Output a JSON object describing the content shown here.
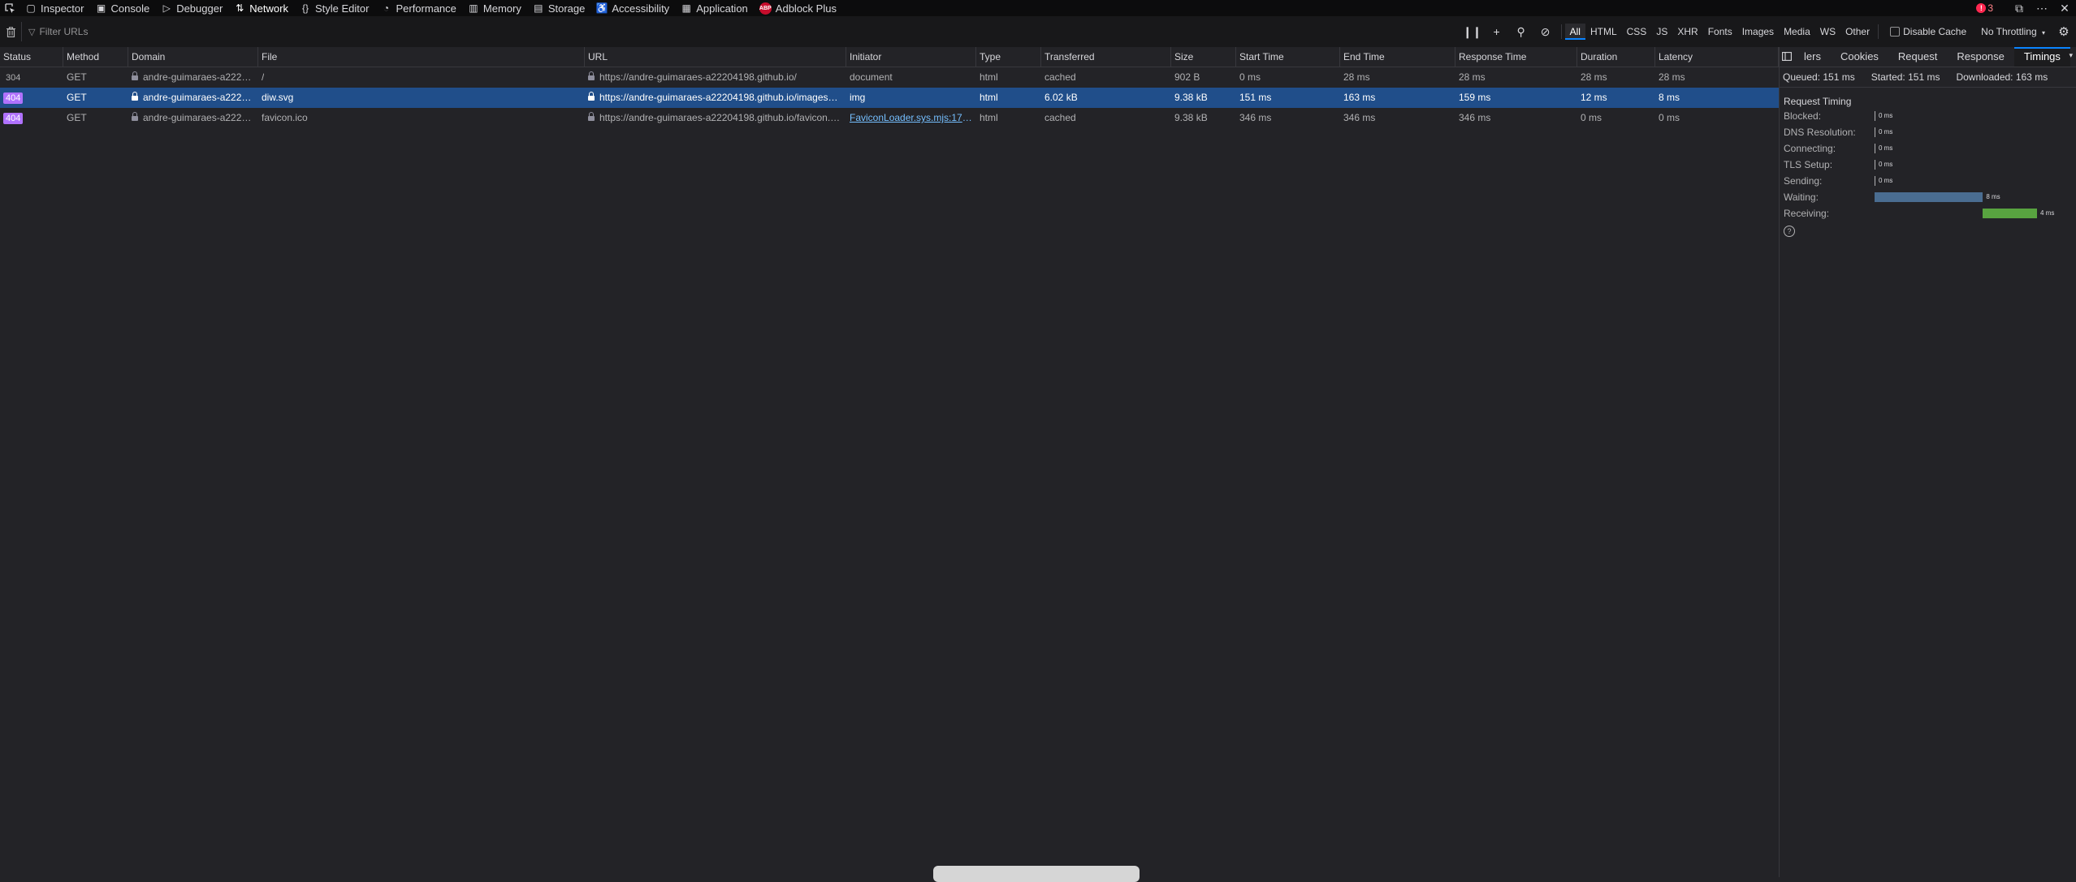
{
  "toolbar": {
    "tabs": [
      {
        "label": "Inspector",
        "icon": "inspector-icon"
      },
      {
        "label": "Console",
        "icon": "console-icon"
      },
      {
        "label": "Debugger",
        "icon": "debugger-icon"
      },
      {
        "label": "Network",
        "icon": "network-icon",
        "active": true
      },
      {
        "label": "Style Editor",
        "icon": "style-editor-icon"
      },
      {
        "label": "Performance",
        "icon": "performance-icon"
      },
      {
        "label": "Memory",
        "icon": "memory-icon"
      },
      {
        "label": "Storage",
        "icon": "storage-icon"
      },
      {
        "label": "Accessibility",
        "icon": "accessibility-icon"
      },
      {
        "label": "Application",
        "icon": "application-icon"
      },
      {
        "label": "Adblock Plus",
        "icon": "adblock-plus-icon"
      }
    ],
    "adblock_badge": "ABP",
    "error_count": "3"
  },
  "filter": {
    "placeholder": "Filter URLs",
    "types": [
      "All",
      "HTML",
      "CSS",
      "JS",
      "XHR",
      "Fonts",
      "Images",
      "Media",
      "WS",
      "Other"
    ],
    "active_type": "All",
    "disable_cache_label": "Disable Cache",
    "throttling": "No Throttling"
  },
  "columns": [
    "Status",
    "Method",
    "Domain",
    "File",
    "URL",
    "Initiator",
    "Type",
    "Transferred",
    "Size",
    "Start Time",
    "End Time",
    "Response Time",
    "Duration",
    "Latency"
  ],
  "requests": [
    {
      "status": "304",
      "method": "GET",
      "domain": "andre-guimaraes-a222…",
      "file": "/",
      "url": "https://andre-guimaraes-a22204198.github.io/",
      "initiator": "document",
      "type": "html",
      "transferred": "cached",
      "size": "902 B",
      "start": "0 ms",
      "end": "28 ms",
      "response": "28 ms",
      "duration": "28 ms",
      "latency": "28 ms"
    },
    {
      "status": "404",
      "method": "GET",
      "domain": "andre-guimaraes-a222…",
      "file": "diw.svg",
      "url": "https://andre-guimaraes-a22204198.github.io/images…",
      "initiator": "img",
      "type": "html",
      "transferred": "6.02 kB",
      "size": "9.38 kB",
      "start": "151 ms",
      "end": "163 ms",
      "response": "159 ms",
      "duration": "12 ms",
      "latency": "8 ms"
    },
    {
      "status": "404",
      "method": "GET",
      "domain": "andre-guimaraes-a222…",
      "file": "favicon.ico",
      "url": "https://andre-guimaraes-a22204198.github.io/favicon.…",
      "initiator": "FaviconLoader.sys.mjs:175…",
      "type": "html",
      "transferred": "cached",
      "size": "9.38 kB",
      "start": "346 ms",
      "end": "346 ms",
      "response": "346 ms",
      "duration": "0 ms",
      "latency": "0 ms"
    }
  ],
  "sidepanel": {
    "tabs": [
      "lers",
      "Cookies",
      "Request",
      "Response",
      "Timings"
    ],
    "active_tab": "Timings",
    "summary": {
      "queued": "Queued: 151 ms",
      "started": "Started: 151 ms",
      "downloaded": "Downloaded: 163 ms"
    },
    "timing_title": "Request Timing",
    "timings": [
      {
        "label": "Blocked:",
        "value": "0 ms",
        "offset": 0,
        "ms": 0,
        "color": "#b1b1b3"
      },
      {
        "label": "DNS Resolution:",
        "value": "0 ms",
        "offset": 0,
        "ms": 0,
        "color": "#b1b1b3"
      },
      {
        "label": "Connecting:",
        "value": "0 ms",
        "offset": 0,
        "ms": 0,
        "color": "#b1b1b3"
      },
      {
        "label": "TLS Setup:",
        "value": "0 ms",
        "offset": 0,
        "ms": 0,
        "color": "#b1b1b3"
      },
      {
        "label": "Sending:",
        "value": "0 ms",
        "offset": 0,
        "ms": 0,
        "color": "#b1b1b3"
      },
      {
        "label": "Waiting:",
        "value": "8 ms",
        "offset": 0,
        "ms": 8,
        "color": "#4a6d91"
      },
      {
        "label": "Receiving:",
        "value": "4 ms",
        "offset": 8,
        "ms": 4,
        "color": "#58a340"
      }
    ],
    "total_ms": 12
  }
}
